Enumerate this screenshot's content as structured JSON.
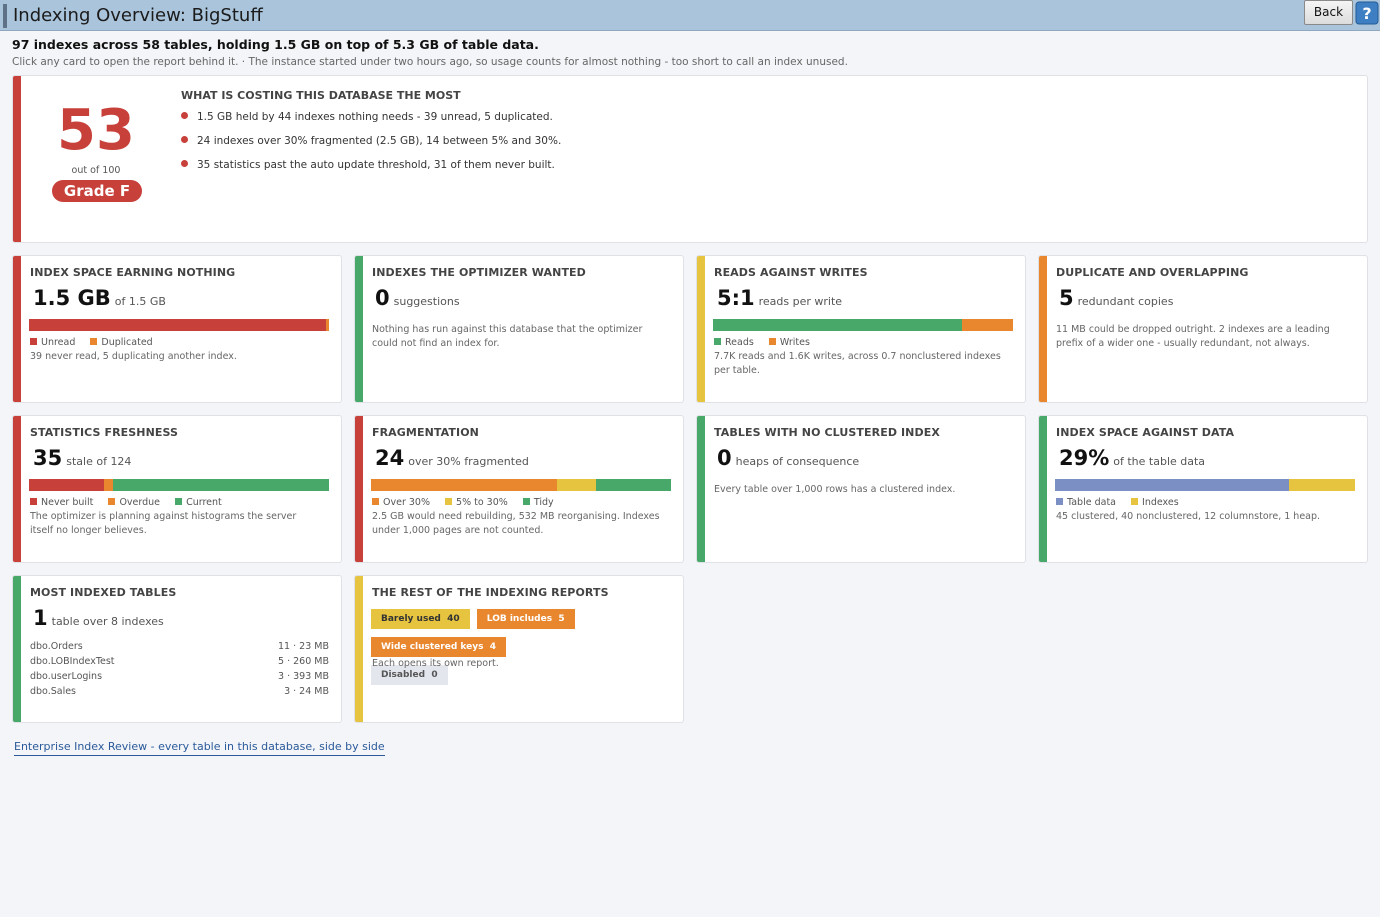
{
  "window": {
    "title": "Indexing Overview: BigStuff",
    "back_label": "Back",
    "help_icon": "help-question-icon"
  },
  "summary": "97 indexes across 58 tables, holding 1.5 GB on top of 5.3 GB of table data.",
  "hint": "Click any card to open the report behind it.  ·  The instance started under two hours ago, so usage counts for almost nothing - too short to call an index unused.",
  "score": {
    "value": "53",
    "out_of": "out of 100",
    "grade": "Grade F",
    "costing_title": "WHAT IS COSTING THIS DATABASE THE MOST",
    "items": [
      "1.5 GB held by 44 indexes nothing needs - 39 unread, 5 duplicated.",
      "24 indexes over 30% fragmented (2.5 GB), 14 between 5% and 30%.",
      "35 statistics past the auto update threshold, 31 of them never built."
    ]
  },
  "colors": {
    "red": "#c8403a",
    "green": "#47a86a",
    "yellow": "#e6c440",
    "orange": "#e9872f",
    "blue": "#7b8fc4"
  },
  "cards": {
    "space_nothing": {
      "title": "INDEX SPACE EARNING NOTHING",
      "num": "1.5 GB",
      "sub": "of 1.5 GB",
      "bar": {
        "unread": 0.99,
        "duplicated": 0.01
      },
      "legend": [
        "Unread",
        "Duplicated"
      ],
      "desc": "39 never read, 5 duplicating another index."
    },
    "optimizer": {
      "title": "INDEXES THE OPTIMIZER WANTED",
      "num": "0",
      "sub": "suggestions",
      "desc": "Nothing has run against this database that the optimizer could not find an index for."
    },
    "reads_writes": {
      "title": "READS AGAINST WRITES",
      "num": "5:1",
      "sub": "reads per write",
      "bar": {
        "reads": 0.83,
        "writes": 0.17
      },
      "legend": [
        "Reads",
        "Writes"
      ],
      "desc": "7.7K reads and 1.6K writes, across 0.7 nonclustered indexes per table."
    },
    "duplicate": {
      "title": "DUPLICATE AND OVERLAPPING",
      "num": "5",
      "sub": "redundant copies",
      "desc": "11 MB could be dropped outright. 2 indexes are a leading prefix of a wider one - usually redundant, not always."
    },
    "statistics": {
      "title": "STATISTICS FRESHNESS",
      "num": "35",
      "sub": "stale of 124",
      "bar": {
        "never_built": 0.25,
        "overdue": 0.03,
        "current": 0.72
      },
      "legend": [
        "Never built",
        "Overdue",
        "Current"
      ],
      "desc": "The optimizer is planning against histograms the server itself no longer believes."
    },
    "fragmentation": {
      "title": "FRAGMENTATION",
      "num": "24",
      "sub": "over 30% fragmented",
      "bar": {
        "over30": 0.62,
        "mid": 0.13,
        "tidy": 0.25
      },
      "legend": [
        "Over 30%",
        "5% to 30%",
        "Tidy"
      ],
      "desc": "2.5 GB would need rebuilding, 532 MB reorganising. Indexes under 1,000 pages are not counted."
    },
    "heaps": {
      "title": "TABLES WITH NO CLUSTERED INDEX",
      "num": "0",
      "sub": "heaps of consequence",
      "desc": "Every table over 1,000 rows has a clustered index."
    },
    "space_data": {
      "title": "INDEX SPACE AGAINST DATA",
      "num": "29%",
      "sub": "of the table data",
      "bar": {
        "table_data": 0.78,
        "indexes": 0.22
      },
      "legend": [
        "Table data",
        "Indexes"
      ],
      "desc": "45 clustered, 40 nonclustered, 12 columnstore, 1 heap."
    },
    "most_indexed": {
      "title": "MOST INDEXED TABLES",
      "num": "1",
      "sub": "table over 8 indexes",
      "rows": [
        {
          "name": "dbo.Orders",
          "stat": "11  ·  23 MB"
        },
        {
          "name": "dbo.LOBIndexTest",
          "stat": "5  ·  260 MB"
        },
        {
          "name": "dbo.userLogins",
          "stat": "3  ·  393 MB"
        },
        {
          "name": "dbo.Sales",
          "stat": "3  ·  24 MB"
        }
      ]
    },
    "rest": {
      "title": "THE REST OF THE INDEXING REPORTS",
      "pills": [
        {
          "label": "Barely used",
          "count": "40"
        },
        {
          "label": "LOB includes",
          "count": "5"
        },
        {
          "label": "Wide clustered keys",
          "count": "4"
        },
        {
          "label": "Disabled",
          "count": "0"
        }
      ],
      "desc": "Each opens its own report."
    }
  },
  "footer_link": "Enterprise Index Review - every table in this database, side by side"
}
